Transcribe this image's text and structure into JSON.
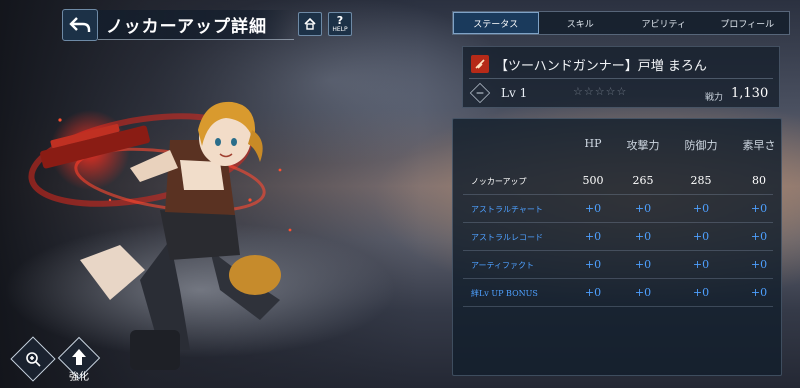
{
  "header": {
    "title": "ノッカーアップ詳細",
    "help_label": "?",
    "help_sub": "HELP"
  },
  "tabs": [
    {
      "label": "ステータス",
      "active": true
    },
    {
      "label": "スキル",
      "active": false
    },
    {
      "label": "アビリティ",
      "active": false
    },
    {
      "label": "プロフィール",
      "active": false
    }
  ],
  "character": {
    "name": "【ツーハンドガンナー】戸増 まろん",
    "level": "Lv 1",
    "stars": "☆☆☆☆☆",
    "power_label": "戦力",
    "power_value": "1,130"
  },
  "stats": {
    "columns": [
      "HP",
      "攻撃力",
      "防御力",
      "素早さ"
    ],
    "rows": [
      {
        "label": "ノッカーアップ",
        "values": [
          "500",
          "265",
          "285",
          "80"
        ],
        "type": "base"
      },
      {
        "label": "アストラルチャート",
        "values": [
          "+0",
          "+0",
          "+0",
          "+0"
        ],
        "type": "sub"
      },
      {
        "label": "アストラルレコード",
        "values": [
          "+0",
          "+0",
          "+0",
          "+0"
        ],
        "type": "sub"
      },
      {
        "label": "アーティファクト",
        "values": [
          "+0",
          "+0",
          "+0",
          "+0"
        ],
        "type": "sub"
      },
      {
        "label": "絆Lv UP BONUS",
        "values": [
          "+0",
          "+0",
          "+0",
          "+0"
        ],
        "type": "sub"
      }
    ]
  },
  "controls": {
    "enhance_label": "強化"
  },
  "colors": {
    "accent_blue": "#4ea0ff",
    "panel": "#121e2c",
    "role_red": "#b62a18",
    "tab_active": "#1a3a5c"
  }
}
